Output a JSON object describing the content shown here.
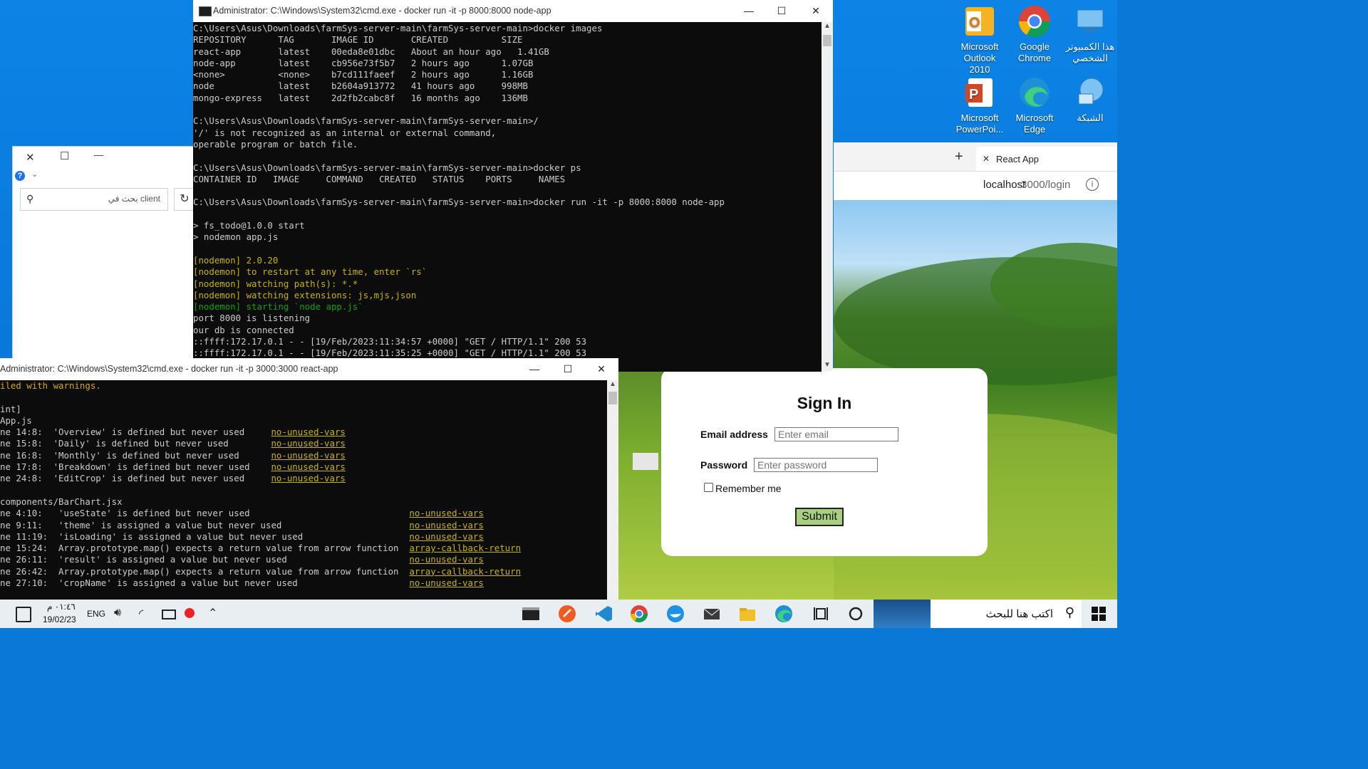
{
  "desktop": {
    "icons": [
      {
        "label_line1": "Microsoft",
        "label_line2": "Outlook 2010",
        "icon": "outlook-icon",
        "color": "#e8a818"
      },
      {
        "label_line1": "Google",
        "label_line2": "Chrome",
        "icon": "chrome-icon",
        "color": "#e8453c"
      },
      {
        "label_line1": "هذا الكمبيوتر",
        "label_line2": "الشخصي",
        "icon": "this-pc-icon",
        "color": "#4aa3e8"
      },
      {
        "label_line1": "Microsoft",
        "label_line2": "PowerPoi...",
        "icon": "powerpoint-icon",
        "color": "#d24726"
      },
      {
        "label_line1": "Microsoft",
        "label_line2": "Edge",
        "icon": "edge-icon",
        "color": "#2fbf85"
      },
      {
        "label_line1": "الشبكة",
        "label_line2": "",
        "icon": "network-icon",
        "color": "#4aa3e8"
      }
    ]
  },
  "side_window": {
    "search_placeholder": "بحث في client",
    "help_glyph": "?"
  },
  "browser": {
    "tab_title": "React App",
    "url_host": "localhost",
    "url_path": ":3000/login",
    "new_tab_glyph": "+",
    "close_tab_glyph": "✕"
  },
  "login": {
    "title": "Sign In",
    "email_label": "Email address",
    "email_placeholder": "Enter email",
    "password_label": "Password",
    "password_placeholder": "Enter password",
    "remember_label": "Remember me",
    "submit_label": "Submit",
    "submit_color": "#a8cf7f"
  },
  "cmd_node": {
    "title": "Administrator: C:\\Windows\\System32\\cmd.exe - docker  run -it -p 8000:8000 node-app",
    "lines": [
      {
        "text": "C:\\Users\\Asus\\Downloads\\farmSys-server-main\\farmSys-server-main>docker images",
        "style": ""
      },
      {
        "text": "REPOSITORY      TAG       IMAGE ID       CREATED          SIZE",
        "style": ""
      },
      {
        "text": "react-app       latest    00eda8e01dbc   About an hour ago   1.41GB",
        "style": ""
      },
      {
        "text": "node-app        latest    cb956e73f5b7   2 hours ago      1.07GB",
        "style": ""
      },
      {
        "text": "<none>          <none>    b7cd111faeef   2 hours ago      1.16GB",
        "style": ""
      },
      {
        "text": "node            latest    b2604a913772   41 hours ago     998MB",
        "style": ""
      },
      {
        "text": "mongo-express   latest    2d2fb2cabc8f   16 months ago    136MB",
        "style": ""
      },
      {
        "text": "",
        "style": ""
      },
      {
        "text": "C:\\Users\\Asus\\Downloads\\farmSys-server-main\\farmSys-server-main>/",
        "style": ""
      },
      {
        "text": "'/' is not recognized as an internal or external command,",
        "style": ""
      },
      {
        "text": "operable program or batch file.",
        "style": ""
      },
      {
        "text": "",
        "style": ""
      },
      {
        "text": "C:\\Users\\Asus\\Downloads\\farmSys-server-main\\farmSys-server-main>docker ps",
        "style": ""
      },
      {
        "text": "CONTAINER ID   IMAGE     COMMAND   CREATED   STATUS    PORTS     NAMES",
        "style": ""
      },
      {
        "text": "",
        "style": ""
      },
      {
        "text": "C:\\Users\\Asus\\Downloads\\farmSys-server-main\\farmSys-server-main>docker run -it -p 8000:8000 node-app",
        "style": ""
      },
      {
        "text": "",
        "style": ""
      },
      {
        "text": "> fs_todo@1.0.0 start",
        "style": ""
      },
      {
        "text": "> nodemon app.js",
        "style": ""
      },
      {
        "text": "",
        "style": ""
      },
      {
        "text": "[nodemon] 2.0.20",
        "style": "yellow"
      },
      {
        "text": "[nodemon] to restart at any time, enter `rs`",
        "style": "yellow"
      },
      {
        "text": "[nodemon] watching path(s): *.*",
        "style": "yellow"
      },
      {
        "text": "[nodemon] watching extensions: js,mjs,json",
        "style": "yellow"
      },
      {
        "text": "[nodemon] starting `node app.js`",
        "style": "green"
      },
      {
        "text": "port 8000 is listening",
        "style": ""
      },
      {
        "text": "our db is connected",
        "style": ""
      },
      {
        "text": "::ffff:172.17.0.1 - - [19/Feb/2023:11:34:57 +0000] \"GET / HTTP/1.1\" 200 53",
        "style": ""
      },
      {
        "text": "::ffff:172.17.0.1 - - [19/Feb/2023:11:35:25 +0000] \"GET / HTTP/1.1\" 200 53",
        "style": ""
      }
    ]
  },
  "cmd_react": {
    "title": "Administrator: C:\\Windows\\System32\\cmd.exe - docker  run -it -p 3000:3000 react-app",
    "lines": [
      {
        "pre": "iled with warnings.",
        "rule": "",
        "style": "ylw2"
      },
      {
        "pre": "",
        "rule": "",
        "style": ""
      },
      {
        "pre": "int]",
        "rule": "",
        "style": ""
      },
      {
        "pre": "App.js",
        "rule": "",
        "style": ""
      },
      {
        "pre": "ne 14:8:  'Overview' is defined but never used     ",
        "rule": "no-unused-vars",
        "style": ""
      },
      {
        "pre": "ne 15:8:  'Daily' is defined but never used        ",
        "rule": "no-unused-vars",
        "style": ""
      },
      {
        "pre": "ne 16:8:  'Monthly' is defined but never used      ",
        "rule": "no-unused-vars",
        "style": ""
      },
      {
        "pre": "ne 17:8:  'Breakdown' is defined but never used    ",
        "rule": "no-unused-vars",
        "style": ""
      },
      {
        "pre": "ne 24:8:  'EditCrop' is defined but never used     ",
        "rule": "no-unused-vars",
        "style": ""
      },
      {
        "pre": "",
        "rule": "",
        "style": ""
      },
      {
        "pre": "components/BarChart.jsx",
        "rule": "",
        "style": ""
      },
      {
        "pre": "ne 4:10:   'useState' is defined but never used                              ",
        "rule": "no-unused-vars",
        "style": ""
      },
      {
        "pre": "ne 9:11:   'theme' is assigned a value but never used                        ",
        "rule": "no-unused-vars",
        "style": ""
      },
      {
        "pre": "ne 11:19:  'isLoading' is assigned a value but never used                    ",
        "rule": "no-unused-vars",
        "style": ""
      },
      {
        "pre": "ne 15:24:  Array.prototype.map() expects a return value from arrow function  ",
        "rule": "array-callback-return",
        "style": ""
      },
      {
        "pre": "ne 26:11:  'result' is assigned a value but never used                       ",
        "rule": "no-unused-vars",
        "style": ""
      },
      {
        "pre": "ne 26:42:  Array.prototype.map() expects a return value from arrow function  ",
        "rule": "array-callback-return",
        "style": ""
      },
      {
        "pre": "ne 27:10:  'cropName' is assigned a value but never used                     ",
        "rule": "no-unused-vars",
        "style": ""
      }
    ]
  },
  "window_controls": {
    "minimize": "—",
    "maximize": "☐",
    "close": "✕"
  },
  "taskbar": {
    "time": "٠١:٤٦ م",
    "date": "19/02/23",
    "language": "ENG",
    "search_placeholder": "اكتب هنا للبحث",
    "apps": [
      {
        "icon": "cmd-icon",
        "color": "#222222"
      },
      {
        "icon": "postman-icon",
        "color": "#ef5b25"
      },
      {
        "icon": "vscode-icon",
        "color": "#1f8ad2"
      },
      {
        "icon": "chrome-icon",
        "color": "#e8453c"
      },
      {
        "icon": "docker-icon",
        "color": "#1d91e6"
      },
      {
        "icon": "mail-icon",
        "color": "#3a3a3a"
      },
      {
        "icon": "file-explorer-icon",
        "color": "#f0c02b"
      },
      {
        "icon": "edge-icon",
        "color": "#2fa7d8"
      }
    ]
  }
}
